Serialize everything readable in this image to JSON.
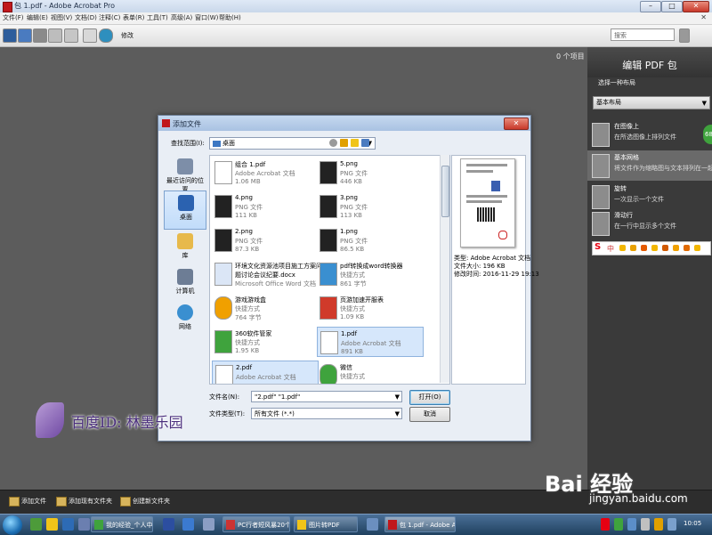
{
  "window": {
    "title": "包 1.pdf - Adobe Acrobat Pro",
    "controls": {
      "minimize": "–",
      "maximize": "□",
      "close": "✕"
    }
  },
  "menu": {
    "items": [
      "文件(F)",
      "编辑(E)",
      "视图(V)",
      "文档(D)",
      "注释(C)",
      "表单(R)",
      "工具(T)",
      "高级(A)",
      "窗口(W)",
      "帮助(H)"
    ],
    "close": "✕"
  },
  "toolbar": {
    "edit_label": "修改",
    "search_placeholder": "搜索"
  },
  "workspace": {
    "item_count": "0 个项目"
  },
  "right_panel": {
    "title": "编辑 PDF 包",
    "choose_layout": "选择一种布局",
    "layout_select": "基本布局",
    "layouts": [
      {
        "name": "在图像上",
        "desc": "在所选图像上排列文件",
        "selected": false
      },
      {
        "name": "基本网格",
        "desc": "将文件作为缩略图与文本排列在一起",
        "selected": true
      },
      {
        "name": "旋转",
        "desc": "一次显示一个文件",
        "selected": false
      },
      {
        "name": "滑动行",
        "desc": "在一行中显示多个文件",
        "selected": false
      }
    ],
    "badge": "68",
    "ime": {
      "logo": "S",
      "mode": "中"
    }
  },
  "bottom_bar": {
    "buttons": [
      "添加文件",
      "添加现有文件夹",
      "创建新文件夹"
    ]
  },
  "taskbar": {
    "tasks": [
      "我的经验_个人中心_...",
      "PC行者短风暴20个...",
      "图片转PDF",
      "包 1.pdf - Adobe A..."
    ],
    "time": "10:05"
  },
  "dialog": {
    "title": "添加文件",
    "close": "✕",
    "look_in_label": "查找范围(I):",
    "look_in_value": "桌面",
    "places": [
      "最近访问的位置",
      "桌面",
      "库",
      "计算机",
      "网络"
    ],
    "files": [
      {
        "name": "组合 1.pdf",
        "type": "Adobe Acrobat 文档",
        "size": "1.06 MB",
        "selected": false
      },
      {
        "name": "5.png",
        "type": "PNG 文件",
        "size": "446 KB",
        "selected": false
      },
      {
        "name": "4.png",
        "type": "PNG 文件",
        "size": "111 KB",
        "selected": false
      },
      {
        "name": "3.png",
        "type": "PNG 文件",
        "size": "113 KB",
        "selected": false
      },
      {
        "name": "2.png",
        "type": "PNG 文件",
        "size": "87.3 KB",
        "selected": false
      },
      {
        "name": "1.png",
        "type": "PNG 文件",
        "size": "86.5 KB",
        "selected": false
      },
      {
        "name": "环境文化资源池项目施工方案问",
        "type": "题讨论会议纪要.docx",
        "size": "Microsoft Office Word 文档",
        "selected": false
      },
      {
        "name": "pdf转换成word转换器",
        "type": "快捷方式",
        "size": "861 字节",
        "selected": false
      },
      {
        "name": "游戏游戏盒",
        "type": "快捷方式",
        "size": "764 字节",
        "selected": false
      },
      {
        "name": "页游加速开服表",
        "type": "快捷方式",
        "size": "1.09 KB",
        "selected": false
      },
      {
        "name": "360软件管家",
        "type": "快捷方式",
        "size": "1.95 KB",
        "selected": false
      },
      {
        "name": "1.pdf",
        "type": "Adobe Acrobat 文档",
        "size": "891 KB",
        "selected": true
      },
      {
        "name": "2.pdf",
        "type": "Adobe Acrobat 文档",
        "size": "",
        "selected": true
      },
      {
        "name": "微信",
        "type": "快捷方式",
        "size": "",
        "selected": false
      }
    ],
    "preview": {
      "type": "类型: Adobe Acrobat 文档",
      "size": "文件大小: 196 KB",
      "modified": "修改时间: 2016-11-29 19:13"
    },
    "filename_label": "文件名(N):",
    "filename_value": "\"2.pdf\" \"1.pdf\"",
    "filetype_label": "文件类型(T):",
    "filetype_value": "所有文件 (*.*)",
    "open_button": "打开(O)",
    "cancel_button": "取消"
  },
  "overlays": {
    "baidu_id": "百度ID: 林墨乐园",
    "logo": "Bai 经验",
    "url": "jingyan.baidu.com"
  }
}
